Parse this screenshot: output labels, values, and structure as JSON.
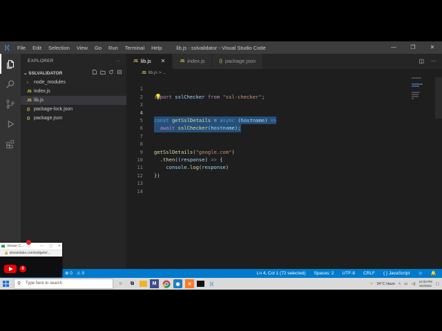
{
  "titlebar": {
    "menu": [
      "File",
      "Edit",
      "Selection",
      "View",
      "Go",
      "Run",
      "Terminal",
      "Help"
    ],
    "window_title": "lib.js - sslvalidator - Visual Studio Code"
  },
  "sidebar": {
    "title": "EXPLORER",
    "more": "···",
    "folder": "SSLVALIDATOR",
    "items": [
      {
        "label": "node_modules",
        "type": "folder"
      },
      {
        "label": "index.js",
        "type": "js"
      },
      {
        "label": "lib.js",
        "type": "js"
      },
      {
        "label": "package-lock.json",
        "type": "json"
      },
      {
        "label": "package.json",
        "type": "json"
      }
    ]
  },
  "tabs": [
    {
      "label": "lib.js",
      "type": "js"
    },
    {
      "label": "index.js",
      "type": "js"
    },
    {
      "label": "package.json",
      "type": "json"
    }
  ],
  "breadcrumb": {
    "file": "lib.js",
    "sep": ">",
    "more": "..."
  },
  "editor": {
    "lines": [
      {
        "n": "1",
        "code": "import sslChecker from \"ssl-checker\";"
      },
      {
        "n": "2",
        "code": ""
      },
      {
        "n": "3",
        "code": ""
      },
      {
        "n": "4",
        "code": "const getSslDetails = async (hostname) =>"
      },
      {
        "n": "5",
        "code": "  await sslChecker(hostname);"
      },
      {
        "n": "6",
        "code": ""
      },
      {
        "n": "7",
        "code": ""
      },
      {
        "n": "8",
        "code": "getSslDetails(\"google.com\")"
      },
      {
        "n": "9",
        "code": "  .then((response) => {"
      },
      {
        "n": "10",
        "code": "    console.log(response)"
      },
      {
        "n": "11",
        "code": "})"
      },
      {
        "n": "12",
        "code": ""
      },
      {
        "n": "13",
        "code": ""
      },
      {
        "n": "14",
        "code": ""
      }
    ]
  },
  "status": {
    "errors": "⊗ 0",
    "warnings": "⚠ 0",
    "position": "Ln 4, Col 1 (72 selected)",
    "spaces": "Spaces: 2",
    "encoding": "UTF-8",
    "eol": "CRLF",
    "language": "{ } JavaScript"
  },
  "taskbar": {
    "search_placeholder": "Type here to search",
    "weather": "34°C Haze",
    "time": "10:33 PM",
    "date": "5/2/2022"
  },
  "popup": {
    "title": "Viewer C...",
    "url": "streamlabs.com/widgets/...",
    "count": "0"
  },
  "colors": {
    "status_bar": "#007acc",
    "title_bar": "#3c3c3c",
    "activity_bar": "#333333",
    "sidebar": "#252526",
    "editor_bg": "#1e1e1e",
    "selection": "#264f78"
  }
}
